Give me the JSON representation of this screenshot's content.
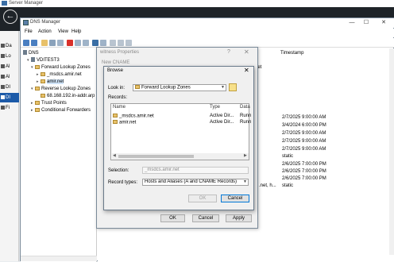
{
  "server_manager": {
    "title": "Server Manager",
    "nav": [
      "Da",
      "Lo",
      "Al",
      "Al",
      "DI",
      "DI",
      "Fi"
    ]
  },
  "dns_manager": {
    "title": "DNS Manager",
    "window_buttons": {
      "minimize": "—",
      "maximize": "☐",
      "close": "✕"
    },
    "menu": [
      "File",
      "Action",
      "View",
      "Help"
    ],
    "tree": {
      "root": "DNS",
      "server": "VDITEST3",
      "forward": "Forward Lookup Zones",
      "msdcs": "_msdcs.amir.net",
      "amir": "amir.net",
      "reverse": "Reverse Lookup Zones",
      "rev_zone": "68.168.192.in-addr.arp",
      "trust": "Trust Points",
      "conditional": "Conditional Forwarders"
    },
    "pane": {
      "timestamp_header": "Timestamp",
      "data_fragment_1": "net",
      "data_fragment_2": ".net, h...",
      "timestamps": [
        "2/7/2025 9:00:00 AM",
        "3/4/2024 6:00:00 PM",
        "2/7/2025 9:00:00 AM",
        "2/7/2025 9:00:00 AM",
        "2/7/2025 9:00:00 AM",
        "static",
        "2/6/2025 7:00:00 PM",
        "2/6/2025 7:00:00 PM",
        "2/6/2025 7:00:00 PM",
        "static"
      ]
    }
  },
  "witness_dialog": {
    "title": "witness Properties",
    "help": "?",
    "close": "✕",
    "tab": "New CNAME",
    "ok": "OK",
    "cancel": "Cancel",
    "apply": "Apply"
  },
  "browse_dialog": {
    "title": "Browse",
    "close": "✕",
    "look_in_label": "Look in:",
    "look_in_value": "Forward Lookup Zones",
    "records_label": "Records:",
    "columns": [
      "Name",
      "Type",
      "Data"
    ],
    "rows": [
      {
        "name": "_msdcs.amir.net",
        "type": "Active Dir...",
        "data": "Runn"
      },
      {
        "name": "amir.net",
        "type": "Active Dir...",
        "data": "Runn"
      }
    ],
    "selection_label": "Selection:",
    "selection_value": "_msdcs.amir.net",
    "record_types_label": "Record types:",
    "record_types_value": "Hosts and Aliases (A and CNAME Records)",
    "ok": "OK",
    "cancel": "Cancel"
  }
}
